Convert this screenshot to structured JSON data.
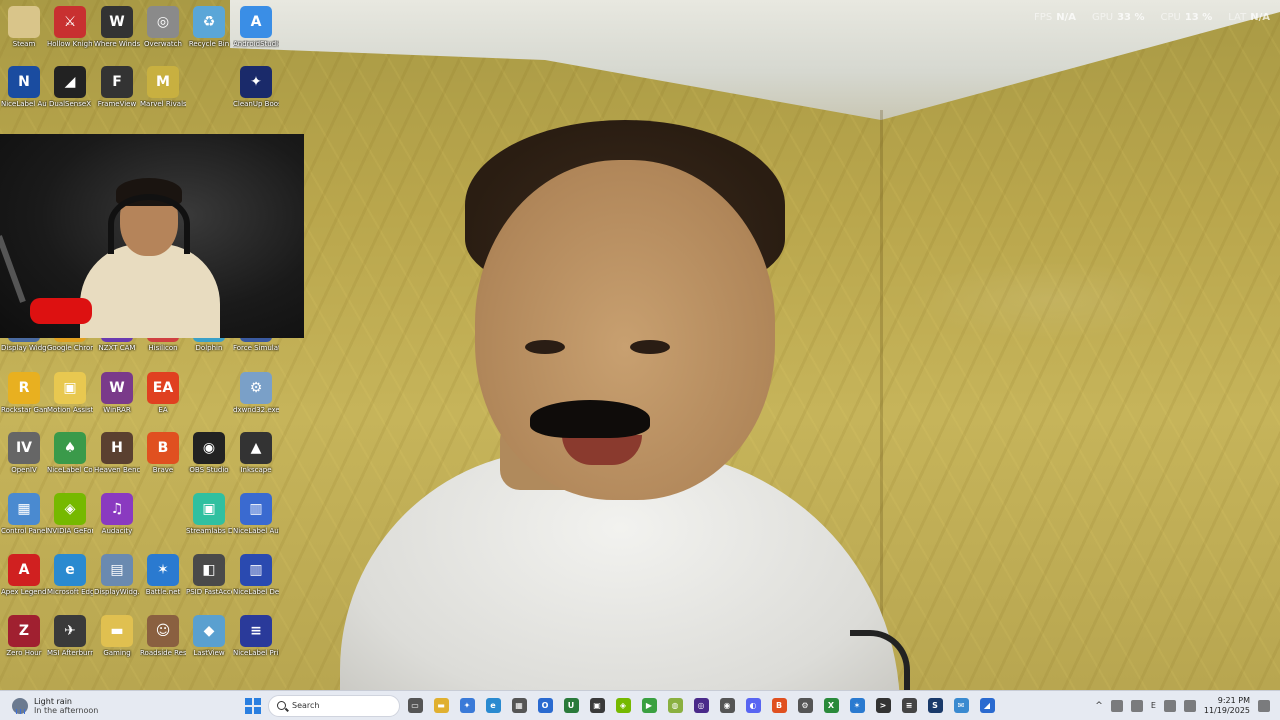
{
  "overlay_stats": [
    {
      "key": "FPS",
      "value": "N/A"
    },
    {
      "key": "GPU",
      "value": "33 %"
    },
    {
      "key": "CPU",
      "value": "13 %"
    },
    {
      "key": "LAT",
      "value": "N/A"
    }
  ],
  "desktop_icons": [
    {
      "label": "Steam",
      "color": "#d9c58a",
      "glyph": ""
    },
    {
      "label": "Hollow Knight",
      "color": "#c83030",
      "glyph": "⚔"
    },
    {
      "label": "Where Winds Meet",
      "color": "#333333",
      "glyph": "W"
    },
    {
      "label": "Overwatch",
      "color": "#8a8a8a",
      "glyph": "◎"
    },
    {
      "label": "Recycle Bin",
      "color": "#5aa6d8",
      "glyph": "♻"
    },
    {
      "label": "AndroidStudio",
      "color": "#3a8ee6",
      "glyph": "A"
    },
    {
      "label": "NiceLabel Automati...",
      "color": "#1a4ca0",
      "glyph": "N"
    },
    {
      "label": "DualSenseX",
      "color": "#222222",
      "glyph": "◢"
    },
    {
      "label": "FrameView",
      "color": "#333333",
      "glyph": "F"
    },
    {
      "label": "Marvel Rivals",
      "color": "#c8b040",
      "glyph": "M"
    },
    {
      "label": "CleanUp Booster",
      "color": "#1a2a6a",
      "glyph": "✦"
    },
    {
      "label": "Display Widget Lite",
      "color": "#4a6aa0",
      "glyph": "D"
    },
    {
      "label": "Google Chrome",
      "color": "#e0a020",
      "glyph": "◉"
    },
    {
      "label": "NZXT CAM",
      "color": "#6a3ab0",
      "glyph": "N"
    },
    {
      "label": "Hisilicon",
      "color": "#d04040",
      "glyph": "H"
    },
    {
      "label": "Dolphin",
      "color": "#3aa0c8",
      "glyph": "D"
    },
    {
      "label": "Force Simulator",
      "color": "#3a5aa0",
      "glyph": "F"
    },
    {
      "label": "Rockstar Games...",
      "color": "#e8b020",
      "glyph": "R"
    },
    {
      "label": "Motion Assistant",
      "color": "#e8c850",
      "glyph": "▣"
    },
    {
      "label": "WinRAR",
      "color": "#7a3a8a",
      "glyph": "W"
    },
    {
      "label": "EA",
      "color": "#e04020",
      "glyph": "EA"
    },
    {
      "label": "dxwnd32.exe",
      "color": "#7aa0c8",
      "glyph": "⚙"
    },
    {
      "label": "OpenIV",
      "color": "#666666",
      "glyph": "IV"
    },
    {
      "label": "NiceLabel Configurati...",
      "color": "#3a9a4a",
      "glyph": "♠"
    },
    {
      "label": "Heaven Benchmar...",
      "color": "#5a4030",
      "glyph": "H"
    },
    {
      "label": "Brave",
      "color": "#e05020",
      "glyph": "B"
    },
    {
      "label": "OBS Studio",
      "color": "#222222",
      "glyph": "◉"
    },
    {
      "label": "Inkscape",
      "color": "#333333",
      "glyph": "▲"
    },
    {
      "label": "Control Panel",
      "color": "#4a8ad0",
      "glyph": "▦"
    },
    {
      "label": "NVIDIA GeFor...",
      "color": "#76b900",
      "glyph": "◈"
    },
    {
      "label": "Audacity",
      "color": "#8a3ac0",
      "glyph": "♫"
    },
    {
      "label": "Streamlabs Desktop",
      "color": "#30c0a0",
      "glyph": "▣"
    },
    {
      "label": "NiceLabel Automati...",
      "color": "#3a6ad0",
      "glyph": "▥"
    },
    {
      "label": "Apex Legends",
      "color": "#d02020",
      "glyph": "A"
    },
    {
      "label": "Microsoft Edge",
      "color": "#2a8ad0",
      "glyph": "e"
    },
    {
      "label": "DisplayWidg... Wallet",
      "color": "#6a8ab0",
      "glyph": "▤"
    },
    {
      "label": "Battle.net",
      "color": "#2a7ad0",
      "glyph": "✶"
    },
    {
      "label": "PSID FastAccess...",
      "color": "#4a4a4a",
      "glyph": "◧"
    },
    {
      "label": "NiceLabel Designer 10",
      "color": "#2a4ab0",
      "glyph": "▥"
    },
    {
      "label": "Zero Hour",
      "color": "#a02030",
      "glyph": "Z"
    },
    {
      "label": "MSI Afterburner",
      "color": "#3a3a3a",
      "glyph": "✈"
    },
    {
      "label": "Gaming",
      "color": "#e0c050",
      "glyph": "▬"
    },
    {
      "label": "Roadside Research",
      "color": "#8a6040",
      "glyph": "☺"
    },
    {
      "label": "LastView",
      "color": "#5aa0d0",
      "glyph": "◆"
    },
    {
      "label": "NiceLabel Print 10",
      "color": "#2a3a9a",
      "glyph": "≡"
    }
  ],
  "taskbar": {
    "weather_line1": "Light rain",
    "weather_line2": "In the afternoon",
    "search_placeholder": "Search",
    "lang": "E",
    "chevron": "^",
    "time": "9:21 PM",
    "date": "11/19/2025",
    "apps": [
      {
        "name": "task-view",
        "color": "#555555",
        "glyph": "▭"
      },
      {
        "name": "file-explorer",
        "color": "#e0b030",
        "glyph": "▬"
      },
      {
        "name": "copilot",
        "color": "#3a7ad8",
        "glyph": "✦"
      },
      {
        "name": "edge",
        "color": "#2a8ad0",
        "glyph": "e"
      },
      {
        "name": "store",
        "color": "#555555",
        "glyph": "▦"
      },
      {
        "name": "outlook",
        "color": "#2a6ad0",
        "glyph": "O"
      },
      {
        "name": "app-u",
        "color": "#2a7a3a",
        "glyph": "U"
      },
      {
        "name": "winrar-app",
        "color": "#3a3a3a",
        "glyph": "▣"
      },
      {
        "name": "nvidia-app",
        "color": "#76b900",
        "glyph": "◈"
      },
      {
        "name": "media-app",
        "color": "#3aa040",
        "glyph": "▶"
      },
      {
        "name": "green-app",
        "color": "#8ab040",
        "glyph": "◍"
      },
      {
        "name": "obs-app",
        "color": "#4a2a8a",
        "glyph": "◎"
      },
      {
        "name": "chrome-app",
        "color": "#555555",
        "glyph": "◉"
      },
      {
        "name": "discord-app",
        "color": "#5865f2",
        "glyph": "◐"
      },
      {
        "name": "brave-app",
        "color": "#e05020",
        "glyph": "B"
      },
      {
        "name": "settings-app",
        "color": "#555555",
        "glyph": "⚙"
      },
      {
        "name": "xbox-app",
        "color": "#2a8a3a",
        "glyph": "X"
      },
      {
        "name": "battlenet-app",
        "color": "#2a7ad0",
        "glyph": "✶"
      },
      {
        "name": "terminal-app",
        "color": "#333333",
        "glyph": ">"
      },
      {
        "name": "audio-app",
        "color": "#444444",
        "glyph": "≡"
      },
      {
        "name": "steam-app",
        "color": "#1a3a6a",
        "glyph": "S"
      },
      {
        "name": "chat-app",
        "color": "#3a8ad0",
        "glyph": "✉"
      },
      {
        "name": "tool-app",
        "color": "#2a6ad0",
        "glyph": "◢"
      }
    ]
  }
}
